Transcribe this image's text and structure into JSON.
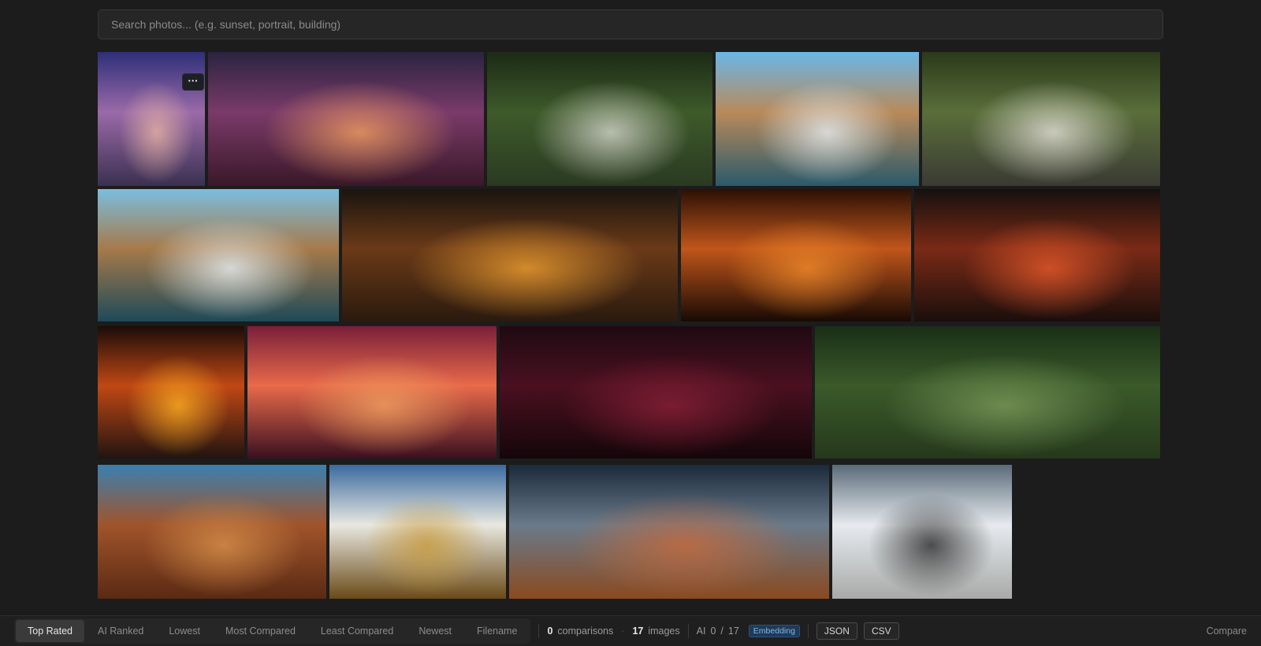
{
  "search": {
    "placeholder": "Search photos... (e.g. sunset, portrait, building)"
  },
  "gallery": {
    "more_button_label": "···",
    "photos": [
      {
        "subject": "twilight-beach",
        "colors": [
          "#2e2f79",
          "#9a6aa8",
          "#e8b4a4",
          "#3a3050"
        ]
      },
      {
        "subject": "lake-sunset-pink",
        "colors": [
          "#2a2440",
          "#7a3a6a",
          "#f4a060",
          "#3a1828"
        ]
      },
      {
        "subject": "forest-waterfall",
        "colors": [
          "#1c2a16",
          "#3e5a2a",
          "#d8d8d0",
          "#2a3a22"
        ]
      },
      {
        "subject": "rocky-coast-waves",
        "colors": [
          "#6ab6e6",
          "#b88a5a",
          "#e8eef2",
          "#2a5a6a"
        ]
      },
      {
        "subject": "cascade-waterfall",
        "colors": [
          "#2a3a1a",
          "#5a6e3a",
          "#e8e4dc",
          "#3a3a34"
        ]
      },
      {
        "subject": "rocky-coast-waves-2",
        "colors": [
          "#7abede",
          "#a67a4a",
          "#eaf2f6",
          "#1e4a58"
        ]
      },
      {
        "subject": "night-city-lights",
        "colors": [
          "#1a1410",
          "#6a3a18",
          "#f0a030",
          "#2a1a0e"
        ]
      },
      {
        "subject": "tree-silhouette-sunset",
        "colors": [
          "#2a1006",
          "#c0561a",
          "#f08a2a",
          "#180a04"
        ]
      },
      {
        "subject": "string-lights-sunset",
        "colors": [
          "#14100e",
          "#7a2a16",
          "#e85a2a",
          "#1a0e0c"
        ]
      },
      {
        "subject": "orange-sun",
        "colors": [
          "#1a0c08",
          "#c04814",
          "#ffb020",
          "#201410"
        ]
      },
      {
        "subject": "red-sky-clouds",
        "colors": [
          "#7a1e3a",
          "#e86a4a",
          "#f0a060",
          "#3a1020"
        ]
      },
      {
        "subject": "starry-red-sky",
        "colors": [
          "#1e0a12",
          "#4a1020",
          "#8a2036",
          "#14060a"
        ]
      },
      {
        "subject": "green-river",
        "colors": [
          "#1a2e16",
          "#3a5a2a",
          "#7a9a5a",
          "#26381c"
        ]
      },
      {
        "subject": "desert-butte",
        "colors": [
          "#3a80b0",
          "#a0542a",
          "#d8904a",
          "#5a2a14"
        ]
      },
      {
        "subject": "golden-hills",
        "colors": [
          "#3a6aa0",
          "#e8e8e0",
          "#c89a3a",
          "#6a4a18"
        ]
      },
      {
        "subject": "desert-road",
        "colors": [
          "#1a2a3a",
          "#6a7a8a",
          "#c86a3a",
          "#8a4a20"
        ]
      },
      {
        "subject": "snowy-mountains",
        "colors": [
          "#5a6a78",
          "#e6eaee",
          "#2a2a2a",
          "#a8aaa8"
        ]
      }
    ]
  },
  "toolbar": {
    "sort_tabs": [
      "Top Rated",
      "AI Ranked",
      "Lowest",
      "Most Compared",
      "Least Compared",
      "Newest",
      "Filename"
    ],
    "active_tab": "Top Rated",
    "comparisons_count": "0",
    "comparisons_label": "comparisons",
    "images_count": "17",
    "images_label": "images",
    "ai_label": "AI",
    "ai_done": "0",
    "ai_slash": "/",
    "ai_total": "17",
    "embedding_badge": "Embedding",
    "json_button": "JSON",
    "csv_button": "CSV",
    "compare_link": "Compare"
  }
}
